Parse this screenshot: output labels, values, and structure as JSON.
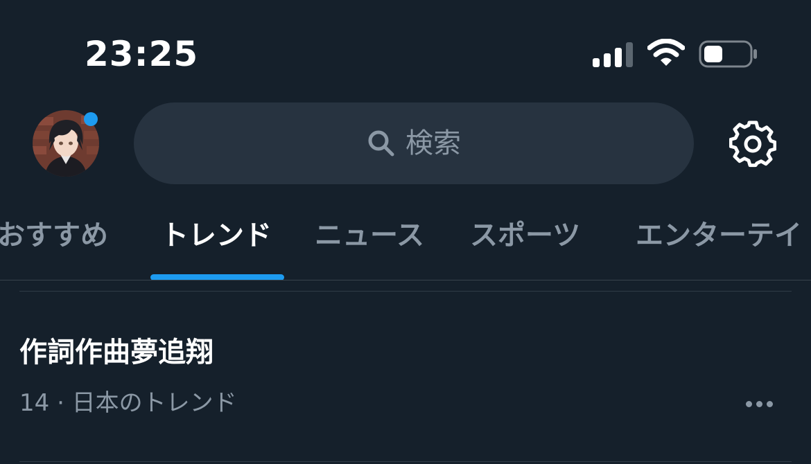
{
  "status_bar": {
    "time": "23:25",
    "icons": [
      "signal-icon",
      "wifi-icon",
      "battery-icon"
    ]
  },
  "header": {
    "avatar_icon": "profile-avatar",
    "notification_dot_color": "#1d9bf0",
    "search_placeholder": "検索",
    "search_icon": "search-icon",
    "settings_icon": "gear-icon"
  },
  "tabs": [
    {
      "label": "おすすめ",
      "active": false
    },
    {
      "label": "トレンド",
      "active": true
    },
    {
      "label": "ニュース",
      "active": false
    },
    {
      "label": "スポーツ",
      "active": false
    },
    {
      "label": "エンターテイ",
      "active": false
    }
  ],
  "trends": [
    {
      "title": "作詞作曲夢追翔",
      "meta": "14 · 日本のトレンド",
      "more_icon": "more-horizontal-icon"
    }
  ],
  "colors": {
    "background": "#15202b",
    "search_bg": "#273340",
    "accent": "#1d9bf0",
    "secondary_text": "#8b98a5"
  }
}
